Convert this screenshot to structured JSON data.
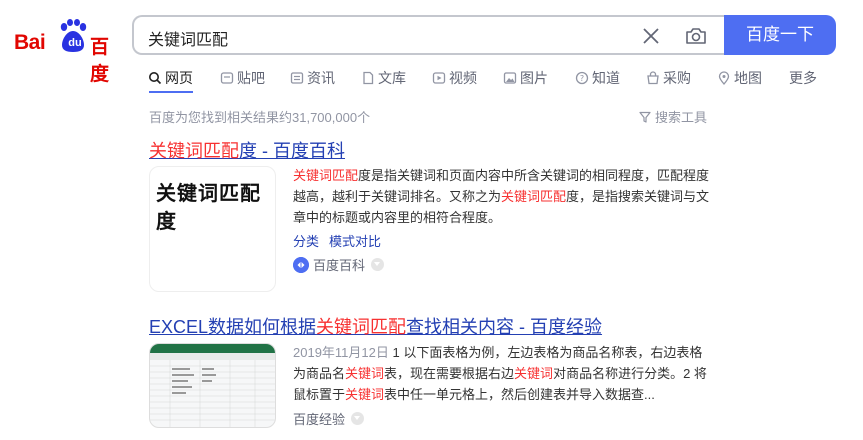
{
  "logo": {
    "bai": "Bai",
    "du": "du",
    "baidu_cn": "百度"
  },
  "search": {
    "query": "关键词匹配",
    "button_label": "百度一下"
  },
  "tabs": [
    {
      "label": "网页",
      "icon": "search-icon",
      "active": true
    },
    {
      "label": "贴吧",
      "icon": "tieba-icon"
    },
    {
      "label": "资讯",
      "icon": "news-icon"
    },
    {
      "label": "文库",
      "icon": "doc-icon"
    },
    {
      "label": "视频",
      "icon": "video-icon"
    },
    {
      "label": "图片",
      "icon": "image-icon"
    },
    {
      "label": "知道",
      "icon": "question-icon"
    },
    {
      "label": "采购",
      "icon": "shop-icon"
    },
    {
      "label": "地图",
      "icon": "map-icon"
    },
    {
      "label": "更多",
      "icon": ""
    }
  ],
  "stats": {
    "text": "百度为您找到相关结果约31,700,000个",
    "tools": "搜索工具"
  },
  "results": [
    {
      "title_em": "关键词匹配",
      "title_rest": "度 - 百度百科",
      "thumb_text": "关键词匹配度",
      "abstract": [
        {
          "t": "关键词匹配",
          "em": true
        },
        {
          "t": "度是指关键词和页面内容中所含关键词的相同程度，匹配程度越高，越利于关键词排名。又称之为"
        },
        {
          "t": "关键词匹配",
          "em": true
        },
        {
          "t": "度，是指搜索关键词与文章中的标题或内容里的相符合程度。"
        }
      ],
      "links": [
        "分类",
        "模式对比"
      ],
      "source": "百度百科"
    },
    {
      "title_pre": "EXCEL数据如何根据",
      "title_em": "关键词匹配",
      "title_rest": "查找相关内容 - 百度经验",
      "date": "2019年11月12日",
      "abstract": [
        {
          "t": " 1 以下面表格为例，左边表格为商品名称表，右边表格为商品名"
        },
        {
          "t": "关键词",
          "em": true
        },
        {
          "t": "表，现在需要根据右边"
        },
        {
          "t": "关键词",
          "em": true
        },
        {
          "t": "对商品名称进行分类。2 将鼠标置于"
        },
        {
          "t": "关键词",
          "em": true
        },
        {
          "t": "表中任一单元格上，然后创建表并导入数据查..."
        }
      ],
      "source": "百度经验"
    }
  ],
  "colors": {
    "brand_red": "#e10601",
    "brand_blue": "#4e6ef2",
    "link": "#2440b3",
    "highlight": "#f73131"
  }
}
